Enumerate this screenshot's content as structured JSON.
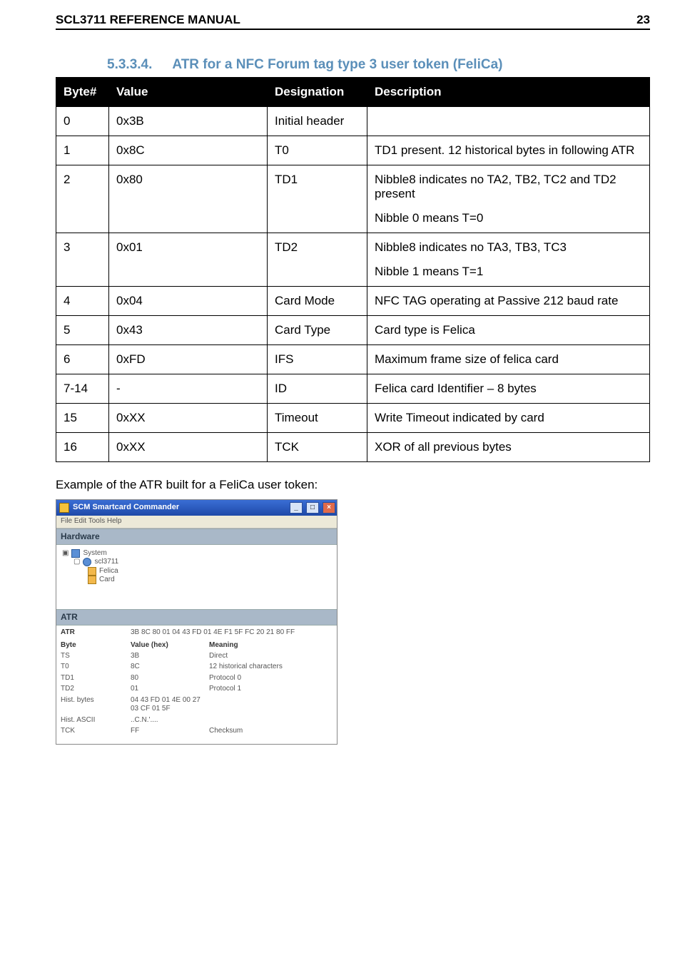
{
  "header": {
    "title": "SCL3711 REFERENCE MANUAL",
    "page": "23"
  },
  "section": {
    "number": "5.3.3.4.",
    "title": "ATR for a NFC Forum tag type 3 user token (FeliCa)"
  },
  "table": {
    "headers": {
      "byte": "Byte#",
      "value": "Value",
      "designation": "Designation",
      "description": "Description"
    },
    "rows": [
      {
        "byte": "0",
        "value": "0x3B",
        "designation": "Initial header",
        "desc": [
          ""
        ]
      },
      {
        "byte": "1",
        "value": "0x8C",
        "designation": "T0",
        "desc": [
          "TD1 present. 12 historical bytes in following ATR"
        ]
      },
      {
        "byte": "2",
        "value": "0x80",
        "designation": "TD1",
        "desc": [
          "Nibble8 indicates no TA2, TB2, TC2 and TD2 present",
          "Nibble 0 means T=0"
        ]
      },
      {
        "byte": "3",
        "value": "0x01",
        "designation": "TD2",
        "desc": [
          "Nibble8 indicates no TA3, TB3, TC3",
          "Nibble 1 means T=1"
        ]
      },
      {
        "byte": "4",
        "value": "0x04",
        "designation": "Card Mode",
        "desc": [
          "NFC TAG operating at Passive 212 baud rate"
        ]
      },
      {
        "byte": "5",
        "value": "0x43",
        "designation": "Card Type",
        "desc": [
          "Card type is Felica"
        ]
      },
      {
        "byte": "6",
        "value": "0xFD",
        "designation": "IFS",
        "desc": [
          "Maximum frame size of felica card"
        ]
      },
      {
        "byte": "7-14",
        "value": "-",
        "designation": "ID",
        "desc": [
          "Felica card Identifier – 8 bytes"
        ]
      },
      {
        "byte": "15",
        "value": "0xXX",
        "designation": "Timeout",
        "desc": [
          "Write Timeout indicated by card"
        ]
      },
      {
        "byte": "16",
        "value": "0xXX",
        "designation": "TCK",
        "desc": [
          "XOR of all previous bytes"
        ]
      }
    ]
  },
  "example_caption": "Example of the ATR built for a FeliCa user token:",
  "screenshot": {
    "app_title": "SCM Smartcard Commander",
    "menubar": "File  Edit  Tools  Help",
    "panel_hardware": "Hardware",
    "tree": {
      "root": "System",
      "node1": "scl3711",
      "node2": "Felica",
      "node3": "Card"
    },
    "panel_atr": "ATR",
    "atr_label": "ATR",
    "atr_value": "3B 8C 80 01 04 43 FD 01 4E F1 5F FC 20 21 80 FF",
    "cols": {
      "byte": "Byte",
      "value": "Value (hex)",
      "meaning": "Meaning"
    },
    "rows": [
      {
        "b": "TS",
        "v": "3B",
        "m": "Direct"
      },
      {
        "b": "T0",
        "v": "8C",
        "m": "12 historical characters"
      },
      {
        "b": "TD1",
        "v": "80",
        "m": "Protocol 0"
      },
      {
        "b": "TD2",
        "v": "01",
        "m": "Protocol 1"
      },
      {
        "b": "Hist. bytes",
        "v": "04 43 FD 01 4E 00 27 03 CF 01 5F",
        "m": ""
      },
      {
        "b": "Hist. ASCII",
        "v": "..C.N.'....",
        "m": ""
      },
      {
        "b": "TCK",
        "v": "FF",
        "m": "Checksum"
      }
    ]
  }
}
